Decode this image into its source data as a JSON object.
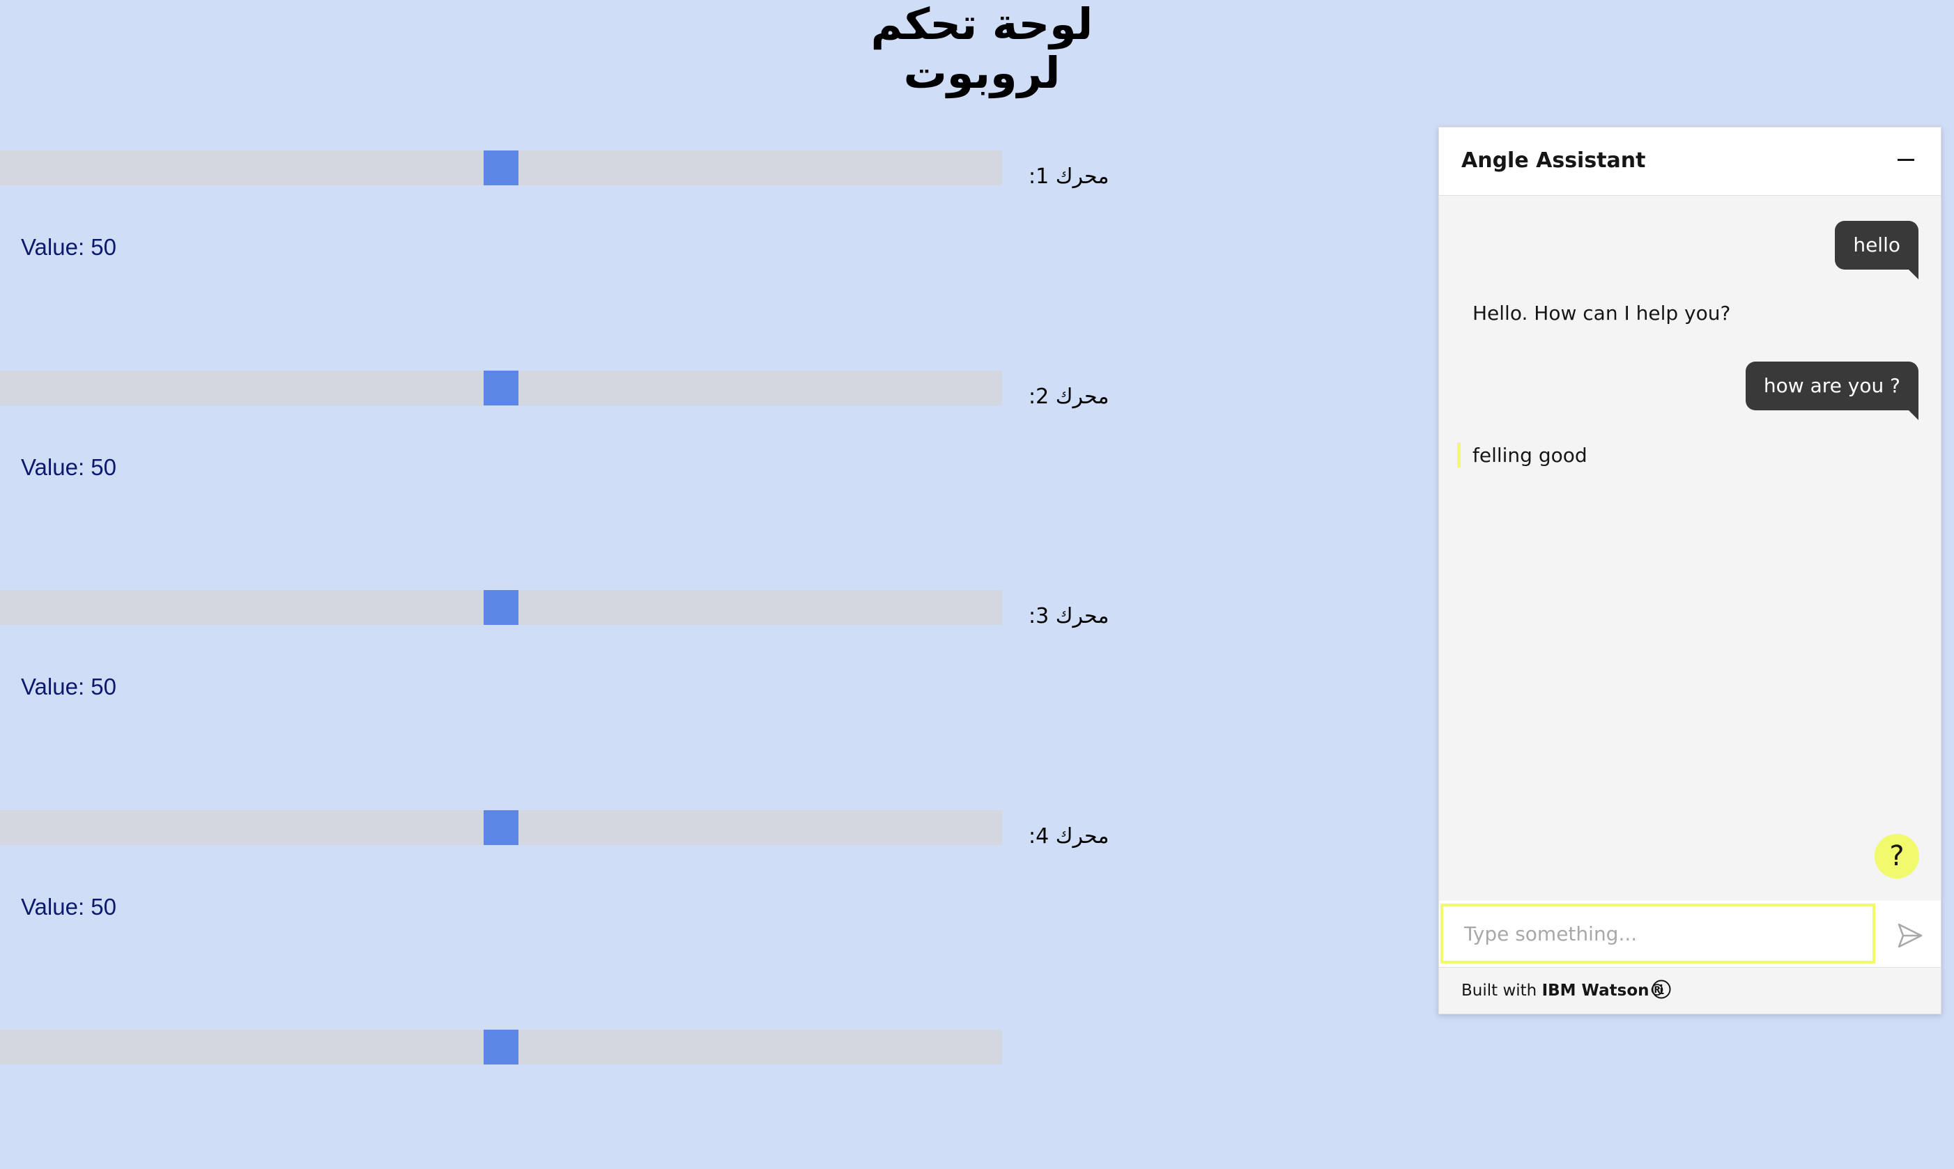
{
  "page": {
    "title": "لوحة تحكم لروبوت"
  },
  "motors": [
    {
      "label": "محرك 1:",
      "value_text": "Value: 50",
      "value": 50
    },
    {
      "label": "محرك 2:",
      "value_text": "Value: 50",
      "value": 50
    },
    {
      "label": "محرك 3:",
      "value_text": "Value: 50",
      "value": 50
    },
    {
      "label": "محرك 4:",
      "value_text": "Value: 50",
      "value": 50
    },
    {
      "value": 50
    }
  ],
  "slider_range": {
    "min": 0,
    "max": 100
  },
  "colors": {
    "background": "#d0ddf6",
    "slider_track": "#d3d7e0",
    "slider_thumb": "#5b86e5",
    "value_text": "#0c1a6e",
    "chat_accent": "#f1f96c",
    "user_bubble": "#393939"
  },
  "chat": {
    "title": "Angle Assistant",
    "minimize_icon": "minimize-icon",
    "messages": [
      {
        "from": "user",
        "text": "hello"
      },
      {
        "from": "bot",
        "text": "Hello. How can I help you?"
      },
      {
        "from": "user",
        "text": "how are you ?"
      },
      {
        "from": "bot",
        "text": "felling good"
      }
    ],
    "help_label": "?",
    "input_placeholder": "Type something...",
    "input_value": "",
    "send_icon": "send-icon",
    "footer_prefix": "Built with ",
    "footer_brand": "IBM Watson®",
    "info_icon": "info-icon"
  }
}
